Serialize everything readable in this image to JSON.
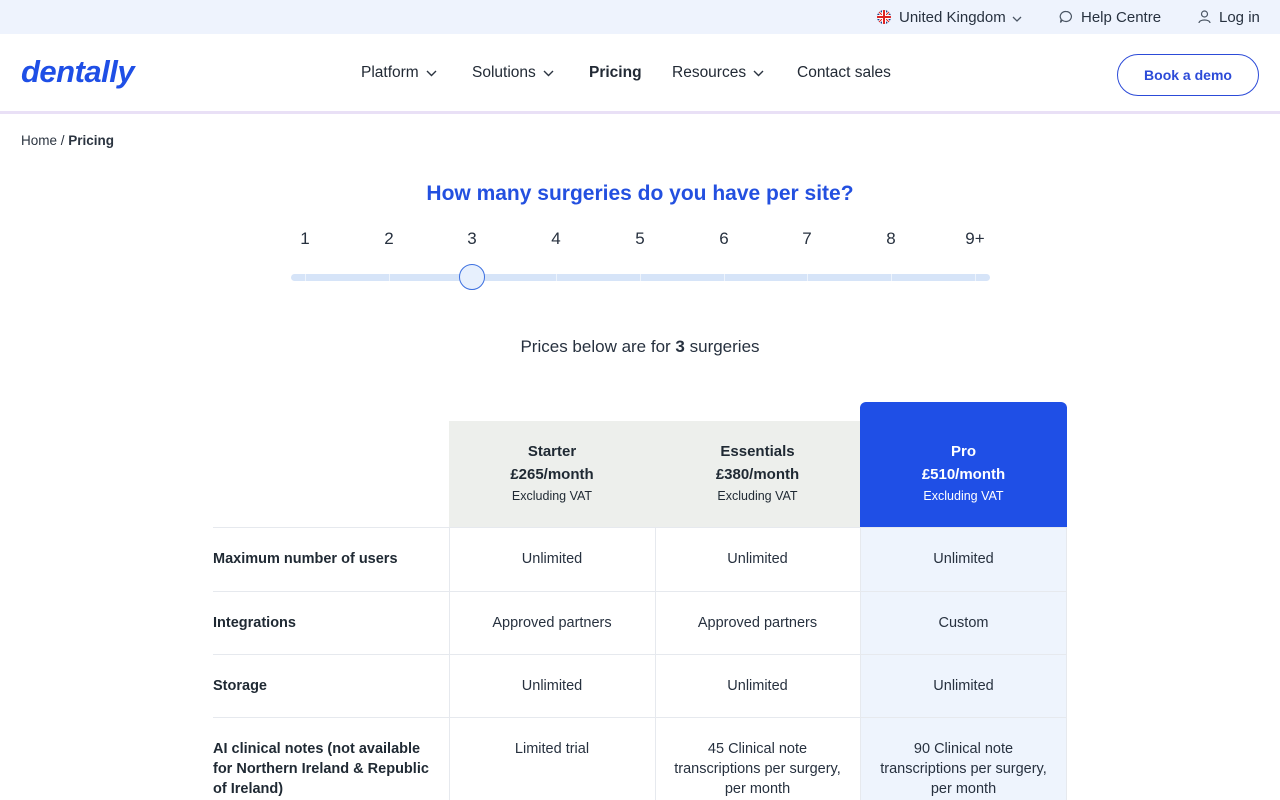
{
  "topbar": {
    "region": "United Kingdom",
    "help": "Help Centre",
    "login": "Log in"
  },
  "nav": {
    "logo": "dentally",
    "items": [
      {
        "label": "Platform"
      },
      {
        "label": "Solutions"
      },
      {
        "label": "Pricing"
      },
      {
        "label": "Resources"
      },
      {
        "label": "Contact sales"
      }
    ],
    "cta": "Book a demo"
  },
  "breadcrumb": {
    "home": "Home",
    "separator": " / ",
    "current": "Pricing"
  },
  "question": "How many surgeries do you have per site?",
  "slider": {
    "labels": [
      "1",
      "2",
      "3",
      "4",
      "5",
      "6",
      "7",
      "8",
      "9+"
    ],
    "selected": "3"
  },
  "prices_note": {
    "prefix": "Prices below are for ",
    "count": "3",
    "suffix": " surgeries"
  },
  "plans": [
    {
      "name": "Starter",
      "price": "£265/month",
      "vat": "Excluding VAT"
    },
    {
      "name": "Essentials",
      "price": "£380/month",
      "vat": "Excluding VAT"
    },
    {
      "name": "Pro",
      "price": "£510/month",
      "vat": "Excluding VAT"
    }
  ],
  "rows": [
    {
      "label": "Maximum number of users",
      "values": [
        "Unlimited",
        "Unlimited",
        "Unlimited"
      ]
    },
    {
      "label": "Integrations",
      "values": [
        "Approved partners",
        "Approved partners",
        "Custom"
      ]
    },
    {
      "label": "Storage",
      "values": [
        "Unlimited",
        "Unlimited",
        "Unlimited"
      ]
    },
    {
      "label": "AI clinical notes (not available for Northern Ireland & Republic of Ireland)",
      "values": [
        "Limited trial",
        "45 Clinical note transcriptions per surgery, per month",
        "90 Clinical note transcriptions per surgery, per month"
      ]
    }
  ],
  "colors": {
    "brand": "#1f4fe6",
    "topbar_bg": "#eef3fd",
    "pro_column_bg": "#eef4fd",
    "plan_header_bg": "#edefec"
  },
  "icons": [
    "uk-flag-icon",
    "chevron-down-icon",
    "chat-bubble-icon",
    "user-icon"
  ]
}
